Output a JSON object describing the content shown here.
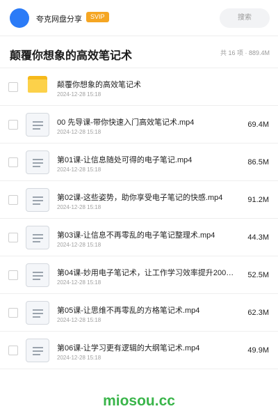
{
  "header": {
    "share_name": "夸克网盘分享",
    "badge": "SVIP",
    "search_placeholder": "搜索"
  },
  "folder": {
    "title": "颠覆你想象的高效笔记术",
    "summary": "共 16 项 · 889.4M"
  },
  "items": [
    {
      "type": "folder",
      "icon": "folder-icon",
      "name": "颠覆你想象的高效笔记术",
      "date": "2024-12-28 15:18",
      "size": ""
    },
    {
      "type": "file",
      "icon": "file-icon",
      "name": "00 先导课-带你快速入门高效笔记术.mp4",
      "date": "2024-12-28 15:18",
      "size": "69.4M"
    },
    {
      "type": "file",
      "icon": "file-icon",
      "name": "第01课-让信息随处可得的电子笔记.mp4",
      "date": "2024-12-28 15:18",
      "size": "86.5M"
    },
    {
      "type": "file",
      "icon": "file-icon",
      "name": "第02课-这些姿势，助你享受电子笔记的快感.mp4",
      "date": "2024-12-28 15:18",
      "size": "91.2M"
    },
    {
      "type": "file",
      "icon": "file-icon",
      "name": "第03课-让信息不再零乱的电子笔记整理术.mp4",
      "date": "2024-12-28 15:18",
      "size": "44.3M"
    },
    {
      "type": "file",
      "icon": "file-icon",
      "name": "第04课-妙用电子笔记术，让工作学习效率提升200…",
      "date": "2024-12-28 15:18",
      "size": "52.5M"
    },
    {
      "type": "file",
      "icon": "file-icon",
      "name": "第05课-让思维不再零乱的方格笔记术.mp4",
      "date": "2024-12-28 15:18",
      "size": "62.3M"
    },
    {
      "type": "file",
      "icon": "file-icon",
      "name": "第06课-让学习更有逻辑的大纲笔记术.mp4",
      "date": "2024-12-28 15:18",
      "size": "49.9M"
    }
  ],
  "watermark": "miosou.cc"
}
